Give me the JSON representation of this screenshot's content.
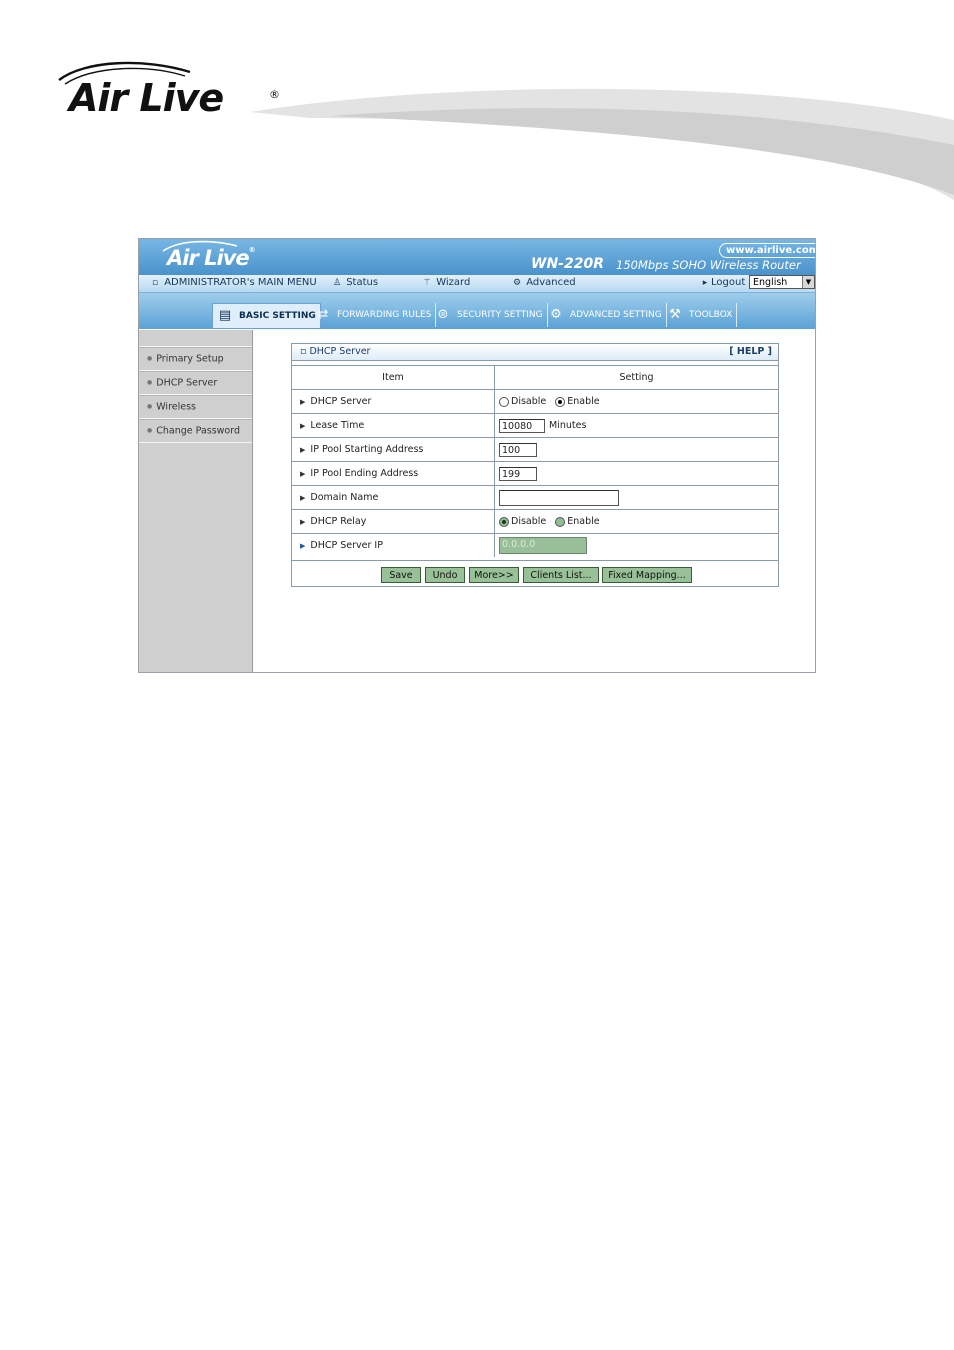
{
  "page": {
    "logo_text": "Air Live",
    "registered_mark": "®"
  },
  "router": {
    "banner": {
      "logo_text": "Air Live",
      "registered_mark": "®",
      "model": "WN-220R",
      "description": "150Mbps SOHO Wireless Router",
      "url": "www.airlive.com"
    },
    "menubar": {
      "main_menu": "ADMINISTRATOR's MAIN MENU",
      "status": "Status",
      "wizard": "Wizard",
      "advanced": "Advanced",
      "logout": "Logout",
      "language": "English"
    },
    "tabs": [
      {
        "label": "BASIC SETTING",
        "active": true
      },
      {
        "label": "FORWARDING RULES",
        "active": false
      },
      {
        "label": "SECURITY SETTING",
        "active": false
      },
      {
        "label": "ADVANCED SETTING",
        "active": false
      },
      {
        "label": "TOOLBOX",
        "active": false
      }
    ],
    "sidebar": {
      "items": [
        {
          "label": "Primary Setup"
        },
        {
          "label": "DHCP Server"
        },
        {
          "label": "Wireless"
        },
        {
          "label": "Change Password"
        }
      ]
    },
    "panel": {
      "title": "DHCP Server",
      "help": "[ HELP ]",
      "col_item": "Item",
      "col_setting": "Setting",
      "rows": {
        "dhcp_server": {
          "label": "DHCP Server",
          "opt_disable": "Disable",
          "opt_enable": "Enable",
          "selected": "Enable"
        },
        "lease_time": {
          "label": "Lease Time",
          "value": "10080",
          "unit": "Minutes"
        },
        "pool_start": {
          "label": "IP Pool Starting Address",
          "value": "100"
        },
        "pool_end": {
          "label": "IP Pool Ending Address",
          "value": "199"
        },
        "domain_name": {
          "label": "Domain Name",
          "value": ""
        },
        "dhcp_relay": {
          "label": "DHCP Relay",
          "opt_disable": "Disable",
          "opt_enable": "Enable",
          "selected": "Disable"
        },
        "dhcp_server_ip": {
          "label": "DHCP Server IP",
          "value": "0.0.0.0"
        }
      },
      "buttons": {
        "save": "Save",
        "undo": "Undo",
        "more": "More>>",
        "clients_list": "Clients List...",
        "fixed_mapping": "Fixed Mapping..."
      }
    }
  }
}
